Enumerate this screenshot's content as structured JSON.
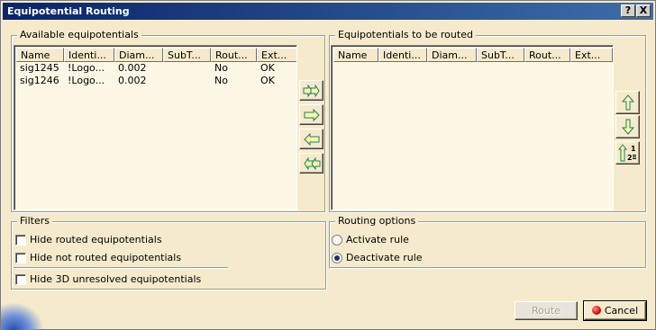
{
  "window": {
    "title": "Equipotential Routing",
    "help_glyph": "?",
    "close_glyph": "X"
  },
  "available": {
    "group_label": "Available equipotentials",
    "columns": [
      "Name",
      "Identi...",
      "Diam...",
      "SubT...",
      "Rout...",
      "Ext..."
    ],
    "rows": [
      [
        "sig1245",
        "!Logo...",
        "0.002",
        "",
        "No",
        "OK"
      ],
      [
        "sig1246",
        "!Logo...",
        "0.002",
        "",
        "No",
        "OK"
      ]
    ]
  },
  "transfer_buttons": {
    "icons": [
      "add-all-icon",
      "add-selected-icon",
      "remove-selected-icon",
      "remove-all-icon"
    ]
  },
  "to_route": {
    "group_label": "Equipotentials to be routed",
    "columns": [
      "Name",
      "Identi...",
      "Diam...",
      "SubT...",
      "Rout...",
      "Ext..."
    ],
    "rows": []
  },
  "order_buttons": {
    "icons": [
      "move-up-icon",
      "move-down-icon",
      "sort-order-icon"
    ]
  },
  "filters": {
    "group_label": "Filters",
    "hide_routed": {
      "label": "Hide routed equipotentials",
      "checked": false
    },
    "hide_not_routed": {
      "label": "Hide not routed equipotentials",
      "checked": false
    },
    "hide_3d_unresolved": {
      "label": "Hide 3D unresolved equipotentials",
      "checked": false
    }
  },
  "routing_options": {
    "group_label": "Routing options",
    "activate": {
      "label": "Activate rule",
      "selected": false
    },
    "deactivate": {
      "label": "Deactivate rule",
      "selected": true
    }
  },
  "footer": {
    "route_label": "Route",
    "route_enabled": false,
    "cancel_label": "Cancel"
  },
  "colors": {
    "dialog_bg": "#f5ebcc",
    "title_bar": "#0a246a",
    "arrow_fill": "#fff8a0",
    "arrow_stroke": "#1a7a7a"
  }
}
